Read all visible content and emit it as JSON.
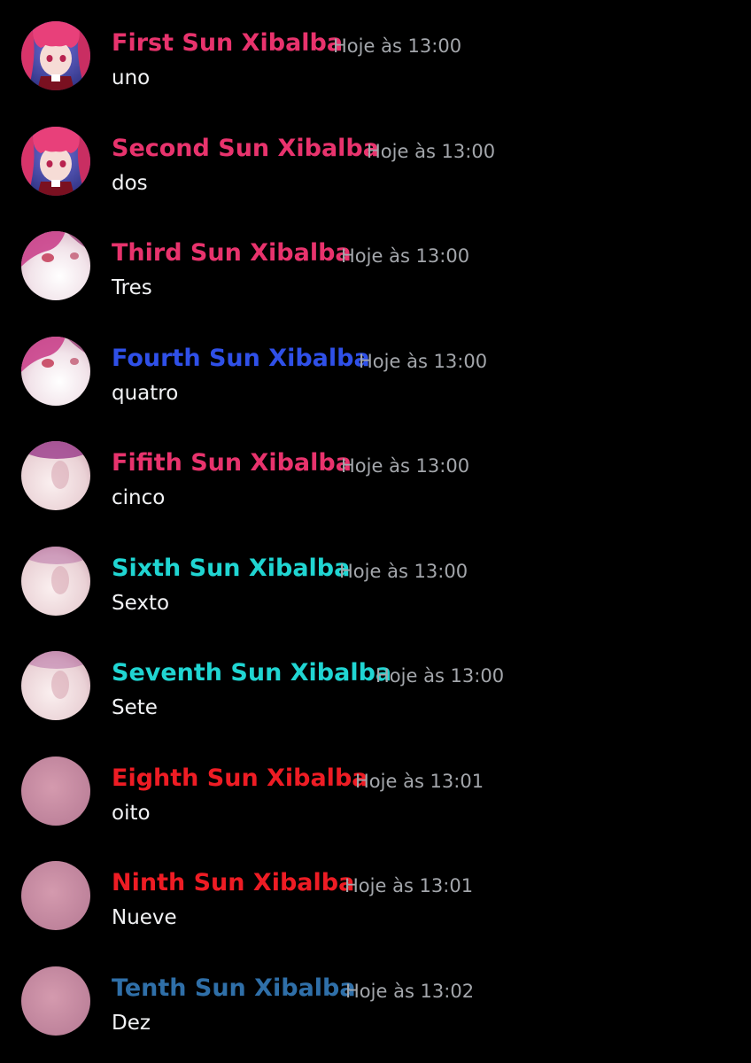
{
  "messages": [
    {
      "author": "First Sun Xibalba",
      "author_color": "#e8336d",
      "timestamp": "Hoje às 13:00",
      "text": "uno",
      "avatar": "anime-girl-avatar"
    },
    {
      "author": "Second Sun Xibalba",
      "author_color": "#e8336d",
      "timestamp": "Hoje às 13:00",
      "text": "dos",
      "avatar": "anime-girl-avatar"
    },
    {
      "author": "Third Sun Xibalba",
      "author_color": "#e8336d",
      "timestamp": "Hoje às 13:00",
      "text": "Tres",
      "avatar": "zoomed-anime-avatar"
    },
    {
      "author": "Fourth Sun Xibalba",
      "author_color": "#2f50e8",
      "timestamp": "Hoje às 13:00",
      "text": "quatro",
      "avatar": "zoomed-anime-avatar"
    },
    {
      "author": "Fifith Sun Xibalba",
      "author_color": "#e8336d",
      "timestamp": "Hoje às 13:00",
      "text": "cinco",
      "avatar": "blurred-avatar"
    },
    {
      "author": "Sixth Sun Xibalba",
      "author_color": "#20d5d2",
      "timestamp": "Hoje às 13:00",
      "text": "Sexto",
      "avatar": "blurred-avatar"
    },
    {
      "author": "Seventh Sun Xibalba",
      "author_color": "#20d5d2",
      "timestamp": "Hoje às 13:00",
      "text": "Sete",
      "avatar": "blurred-avatar"
    },
    {
      "author": "Eighth Sun Xibalba",
      "author_color": "#ee1c24",
      "timestamp": "Hoje às 13:01",
      "text": "oito",
      "avatar": "pink-blur-avatar"
    },
    {
      "author": "Ninth Sun Xibalba",
      "author_color": "#ee1c24",
      "timestamp": "Hoje às 13:01",
      "text": "Nueve",
      "avatar": "pink-blur-avatar"
    },
    {
      "author": "Tenth Sun Xibalba",
      "author_color": "#2f6fa8",
      "timestamp": "Hoje às 13:02",
      "text": "Dez",
      "avatar": "pink-blur-avatar"
    }
  ]
}
